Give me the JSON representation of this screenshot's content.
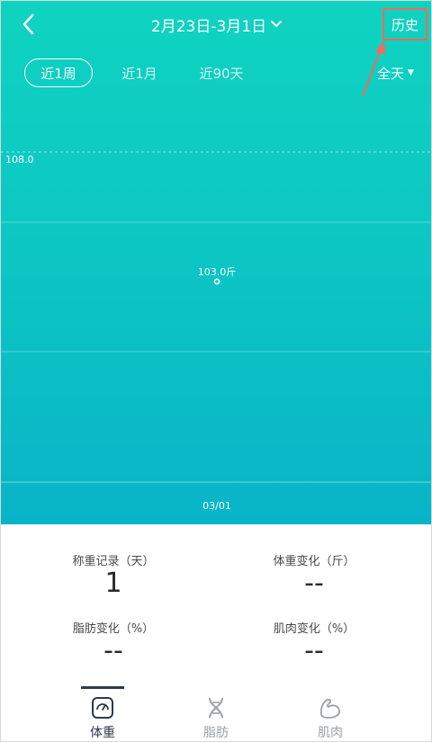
{
  "header": {
    "date_range": "2月23日-3月1日",
    "history_label": "历史"
  },
  "tabs": [
    {
      "label": "近1周",
      "active": true
    },
    {
      "label": "近1月",
      "active": false
    },
    {
      "label": "近90天",
      "active": false
    }
  ],
  "time_filter": {
    "label": "全天"
  },
  "chart_data": {
    "type": "scatter",
    "x": [
      "03/01"
    ],
    "y": [
      103.0
    ],
    "point_label": "103.0斤",
    "y_tick_label": "108.0",
    "x_tick_label": "03/01",
    "grid": true
  },
  "stats": {
    "records_label": "称重记录（天）",
    "records_value": "1",
    "weight_change_label": "体重变化（斤）",
    "weight_change_value": "--",
    "fat_change_label": "脂肪变化（%）",
    "fat_change_value": "--",
    "muscle_change_label": "肌肉变化（%）",
    "muscle_change_value": "--"
  },
  "bottom_nav": [
    {
      "label": "体重",
      "icon": "scale-icon",
      "active": true
    },
    {
      "label": "脂肪",
      "icon": "dna-icon",
      "active": false
    },
    {
      "label": "肌肉",
      "icon": "muscle-icon",
      "active": false
    }
  ],
  "colors": {
    "gradient_top": "#0fd3c0",
    "gradient_bottom": "#09b4c8",
    "annotation": "#f26b5b",
    "nav_active": "#2e3a4a"
  }
}
